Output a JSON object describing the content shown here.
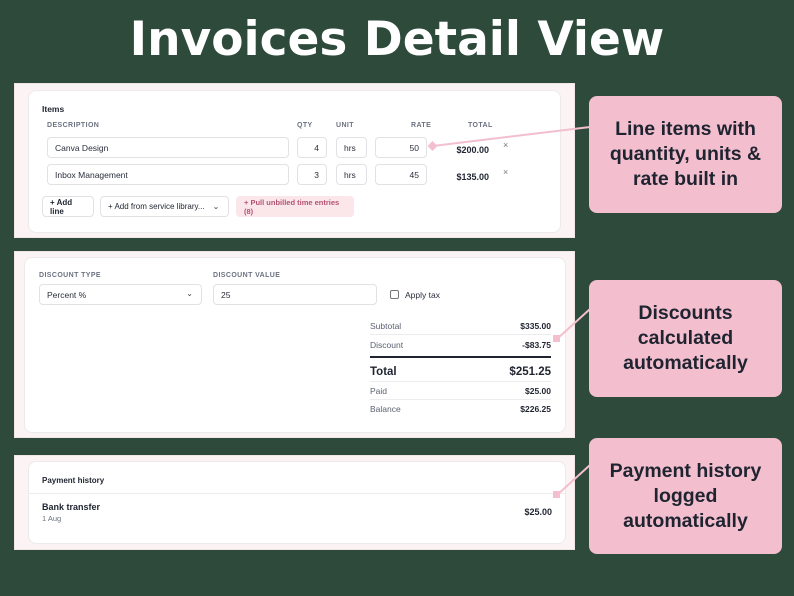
{
  "page_title": "Invoices Detail View",
  "items": {
    "section_title": "Items",
    "headers": {
      "description": "DESCRIPTION",
      "qty": "QTY",
      "unit": "UNIT",
      "rate": "RATE",
      "total": "TOTAL"
    },
    "rows": [
      {
        "description": "Canva Design",
        "qty": "4",
        "unit": "hrs",
        "rate": "50",
        "total": "$200.00",
        "remove": "×"
      },
      {
        "description": "Inbox Management",
        "qty": "3",
        "unit": "hrs",
        "rate": "45",
        "total": "$135.00",
        "remove": "×"
      }
    ],
    "add_line": "+ Add line",
    "add_from_library": "+ Add from service library...",
    "pull_unbilled": "+ Pull unbilled time entries (8)"
  },
  "discount": {
    "type_label": "DISCOUNT TYPE",
    "type_value": "Percent %",
    "value_label": "DISCOUNT VALUE",
    "value": "25",
    "apply_tax_label": "Apply tax",
    "apply_tax_checked": false
  },
  "summary": {
    "subtotal_label": "Subtotal",
    "subtotal": "$335.00",
    "discount_label": "Discount",
    "discount": "-$83.75",
    "total_label": "Total",
    "total": "$251.25",
    "paid_label": "Paid",
    "paid": "$25.00",
    "balance_label": "Balance",
    "balance": "$226.25"
  },
  "payment_history": {
    "section_title": "Payment history",
    "entries": [
      {
        "method": "Bank transfer",
        "date": "1 Aug",
        "amount": "$25.00"
      }
    ]
  },
  "callouts": {
    "line_items": "Line items with\nquantity, units &\nrate built in",
    "discounts": "Discounts\ncalculated\nautomatically",
    "payments": "Payment history\nlogged\nautomatically"
  },
  "colors": {
    "background": "#2d4a3b",
    "callout": "#f3bfcf",
    "connector": "#f3bfcf",
    "panel": "#fbf3f4"
  }
}
